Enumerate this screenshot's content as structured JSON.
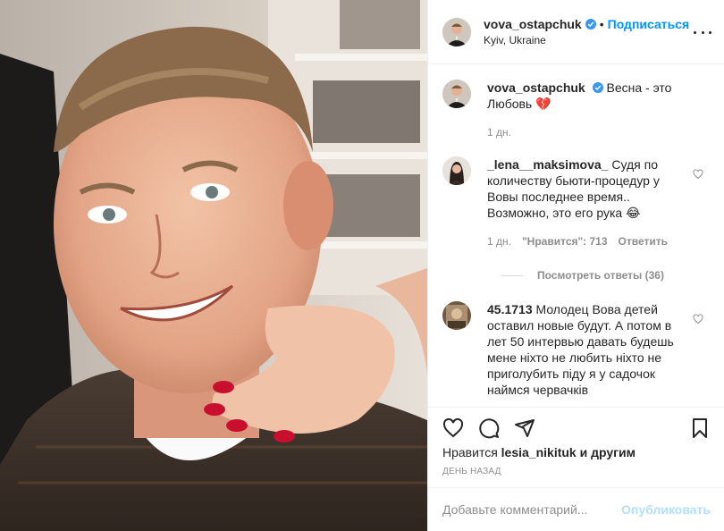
{
  "post": {
    "author": "vova_ostapchuk",
    "location": "Kyiv, Ukraine",
    "follow_label": "Подписаться",
    "separator": "•",
    "caption_text": "Весна - это Любовь",
    "caption_emoji": "💔",
    "caption_time": "1 дн."
  },
  "comments": [
    {
      "username": "_lena__maksimova_",
      "text": "Судя по количеству бьюти-процедур у Вовы последнее время.. Возможно, это его рука",
      "emoji": "😂",
      "time": "1 дн.",
      "likes": "\"Нравится\": 713",
      "reply_label": "Ответить",
      "view_replies": "Посмотреть ответы (36)"
    },
    {
      "username": "45.1713",
      "text": "Молодец Вова детей оставил новые будут. А потом в лет 50 интервью давать будешь мене ніхто не любить ніхто не приголубить піду я у садочок наймся червачків"
    }
  ],
  "likes": {
    "prefix": "Нравится",
    "user": "lesia_nikituk",
    "suffix": "и другим"
  },
  "timestamp": "День назад",
  "add_comment": {
    "placeholder": "Добавьте комментарий...",
    "post_label": "Опубликовать"
  },
  "colors": {
    "accent": "#0095f6",
    "verified": "#3897f0",
    "heart_red": "#c8102e",
    "post_disabled": "#b2dffc"
  }
}
